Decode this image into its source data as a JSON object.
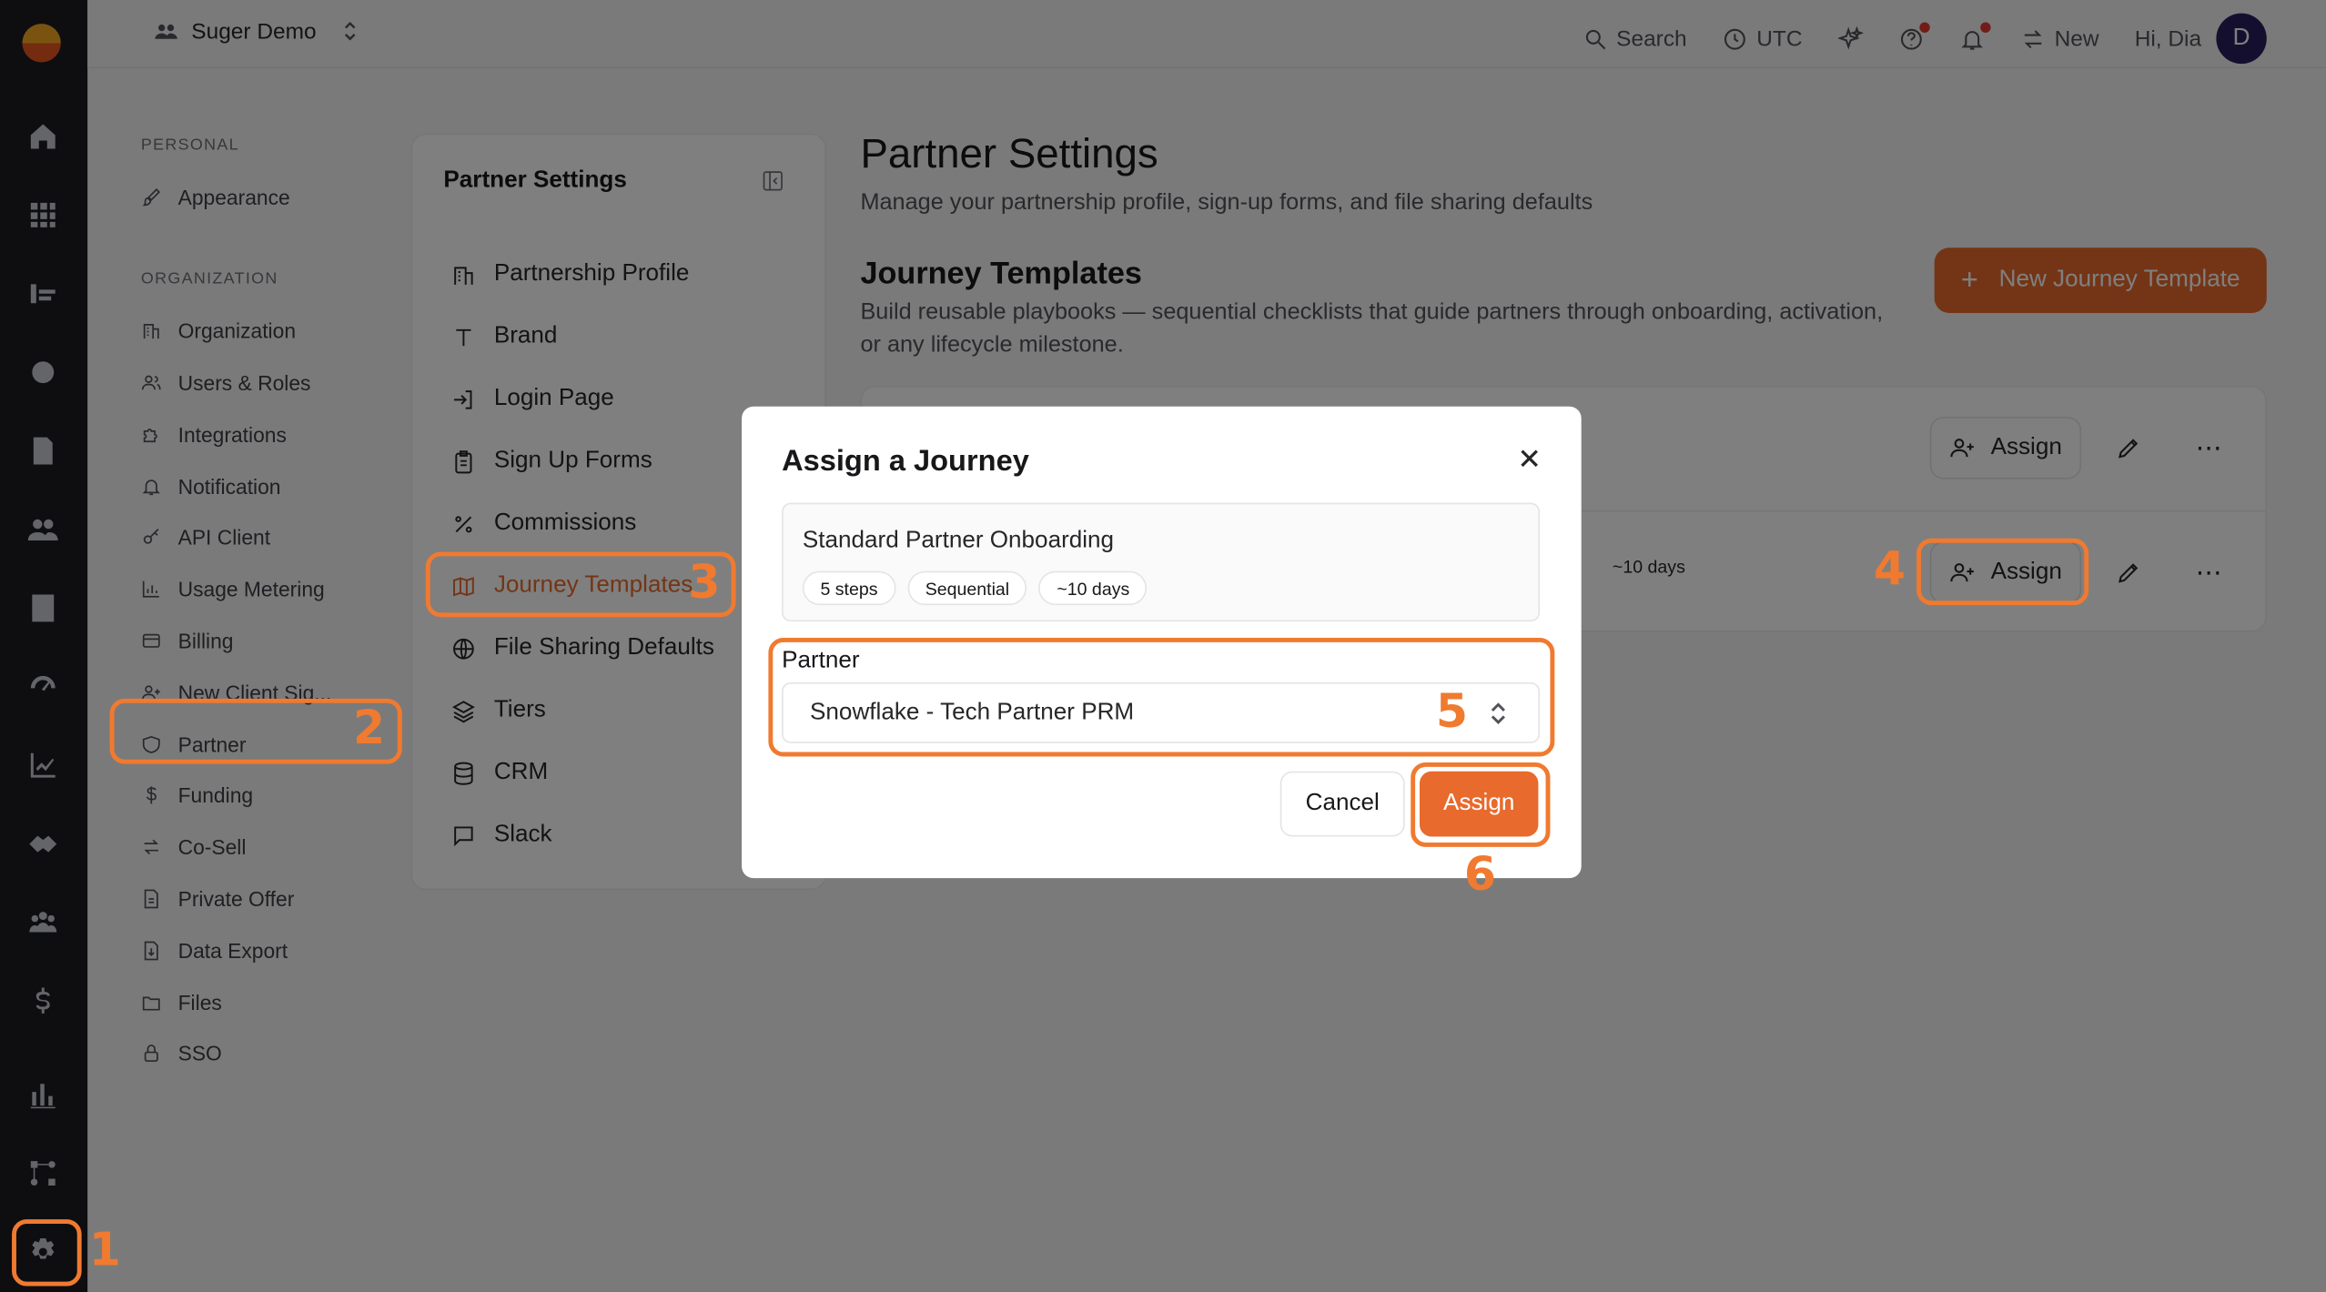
{
  "workspace": {
    "name": "Suger Demo"
  },
  "topbar": {
    "search": "Search",
    "timezone": "UTC",
    "new": "New",
    "greeting": "Hi, Dia",
    "avatar_initial": "D"
  },
  "settings_nav": {
    "personal_header": "PERSONAL",
    "personal_items": [
      {
        "label": "Appearance"
      }
    ],
    "org_header": "ORGANIZATION",
    "org_items": [
      {
        "label": "Organization"
      },
      {
        "label": "Users & Roles"
      },
      {
        "label": "Integrations"
      },
      {
        "label": "Notification"
      },
      {
        "label": "API Client"
      },
      {
        "label": "Usage Metering"
      },
      {
        "label": "Billing"
      },
      {
        "label": "New Client Sig..."
      },
      {
        "label": "Partner"
      },
      {
        "label": "Funding"
      },
      {
        "label": "Co-Sell"
      },
      {
        "label": "Private Offer"
      },
      {
        "label": "Data Export"
      },
      {
        "label": "Files"
      },
      {
        "label": "SSO"
      }
    ]
  },
  "partner_settings_panel": {
    "title": "Partner Settings",
    "items": [
      {
        "label": "Partnership Profile"
      },
      {
        "label": "Brand"
      },
      {
        "label": "Login Page"
      },
      {
        "label": "Sign Up Forms"
      },
      {
        "label": "Commissions"
      },
      {
        "label": "Journey Templates",
        "active": true
      },
      {
        "label": "File Sharing Defaults"
      },
      {
        "label": "Tiers"
      },
      {
        "label": "CRM"
      },
      {
        "label": "Slack"
      }
    ]
  },
  "main": {
    "title": "Partner Settings",
    "subtitle": "Manage your partnership profile, sign-up forms, and file sharing defaults",
    "section_title": "Journey Templates",
    "section_subtitle": "Build reusable playbooks — sequential checklists that guide partners through onboarding, activation, or any lifecycle milestone.",
    "new_button": "New Journey Template",
    "rows": [
      {
        "days": "",
        "assign": "Assign"
      },
      {
        "days": "~10 days",
        "assign": "Assign"
      }
    ]
  },
  "modal": {
    "title": "Assign a Journey",
    "journey_name": "Standard Partner Onboarding",
    "tags": [
      "5 steps",
      "Sequential",
      "~10 days"
    ],
    "partner_label": "Partner",
    "partner_value": "Snowflake - Tech Partner PRM",
    "cancel": "Cancel",
    "assign": "Assign"
  },
  "annotations": [
    "1",
    "2",
    "3",
    "4",
    "5",
    "6"
  ],
  "colors": {
    "accent": "#e86a2c",
    "callout": "#f07a30",
    "rail": "#1c1d22"
  }
}
